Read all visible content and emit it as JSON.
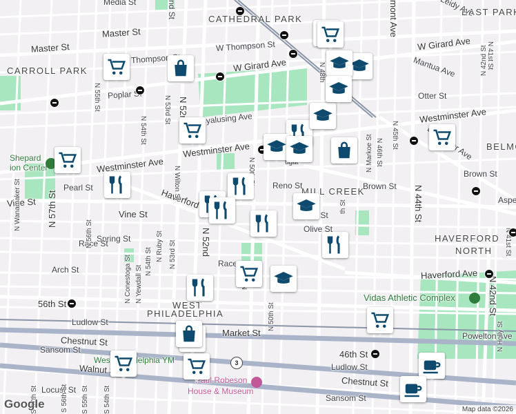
{
  "map": {
    "neighborhoods": [
      "CATHEDRAL PARK",
      "EAST PARK",
      "CARROLL PARK",
      "MILL CREEK",
      "HAVERFORD",
      "NORTH",
      "WEST",
      "PHILADELPHIA",
      "BELMO"
    ],
    "streets": {
      "master": "Master St",
      "w_girard_1": "W Girard Ave",
      "w_girard_2": "W Girard Ave",
      "w_thompson": "W Thompson St",
      "thompson": "Thompson St",
      "poplar": "Poplar St",
      "westminster_1": "Westminster Ave",
      "westminster_2": "Westminster Ave",
      "westminster_3": "Westminster Ave",
      "pearl": "Pearl St",
      "vine": "Vine St",
      "vine_2": "Vine St",
      "haverford": "Haverford Ave",
      "haverford_2": "Haverford Ave",
      "spring": "Spring St",
      "race": "Race St",
      "race_2": "Race",
      "arch": "Arch St",
      "56th": "56th St",
      "ludlow": "Ludlow St",
      "ludlow_2": "Ludlow St",
      "market": "Market St",
      "chestnut": "Chestnut St",
      "chestnut_2": "Chestnut St",
      "sansom": "Sansom St",
      "sansom_2": "Sansom St",
      "walnut": "Walnut St",
      "locust": "Locust St",
      "reno": "Reno St",
      "brown": "Brown St",
      "brown_2": "Brown St",
      "olive": "Olive St",
      "aspen": "Aspen St",
      "aspe": "Aspe",
      "lancaster": "Lancaster Ave",
      "powelton": "Powelton Ave",
      "mantua": "Mantua Ave",
      "otter": "Otter St",
      "leidy": "Leidy Ave",
      "media": "Media St",
      "cya": "Cyalusing Ave",
      "n57": "N 57th St",
      "n56": "N 56th St",
      "n55": "N 55th St",
      "n54": "N 54th St",
      "n53": "N 53rd St",
      "n52": "N 52nd St",
      "n52b": "N 52nd",
      "n51": "N 51",
      "n50": "N 50th St",
      "n50b": "N 50th St",
      "n49": "49th",
      "n48": "N 48th",
      "n46": "N 46th St",
      "n45": "N 45th St",
      "n44": "N 44th St",
      "n42": "N 42nd St",
      "n42b": "N 42nd St",
      "n41": "N 41st St",
      "n41b": "N 41st St",
      "n54b": "N 54th St",
      "s54": "S 54th St",
      "s55": "S 55th St",
      "s56": "S 56th St",
      "s57": "S 57th St",
      "wanamaker": "N Wanamaker St",
      "conestoga": "N Conestoga St",
      "yewdall": "N Yewdall St",
      "ruby": "N Ruby St",
      "wilton": "N Wilton St",
      "markoe": "N Markoe St",
      "holly": "N Holly St",
      "fairmont": "mont Ave",
      "nd": "nd St",
      "ugat": "ugat",
      "h_st": "th St",
      "arch_st": "Arch St",
      "n46b": "46th St",
      "n52c": "52",
      "n48c": "48th",
      "n53c": "N 53rd St",
      "shepard": "Shepard",
      "shepard2": "ion Center",
      "ymca": "West Philadelphia YM",
      "robeson1": "Paul Robeson",
      "robeson2": "House & Museum",
      "vidas": "Vidas Athletic Complex",
      "hwy3": "3"
    },
    "footer": {
      "logo": "Google",
      "credit": "Map data ©2026"
    },
    "colors": {
      "park": "#a8e6bf",
      "water": "#aadaff",
      "rail": "#8a95a8",
      "street": "#ffffff",
      "marker_icon": "#0e4a6e",
      "poi_green": "#2f7d3c",
      "poi_pink": "#c2579a"
    },
    "markers": [
      {
        "type": "grocery-icon"
      },
      {
        "type": "grocery-icon"
      },
      {
        "type": "grocery-icon"
      },
      {
        "type": "grocery-icon"
      },
      {
        "type": "grocery-icon"
      },
      {
        "type": "grocery-icon"
      },
      {
        "type": "grocery-icon"
      },
      {
        "type": "grocery-icon"
      },
      {
        "type": "grocery-icon"
      },
      {
        "type": "grocery-icon"
      },
      {
        "type": "shopping-bag-icon"
      },
      {
        "type": "shopping-bag-icon"
      },
      {
        "type": "shopping-bag-icon"
      },
      {
        "type": "shopping-bag-icon"
      },
      {
        "type": "restaurant-icon"
      },
      {
        "type": "restaurant-icon"
      },
      {
        "type": "restaurant-icon"
      },
      {
        "type": "restaurant-icon"
      },
      {
        "type": "restaurant-icon"
      },
      {
        "type": "restaurant-icon"
      },
      {
        "type": "restaurant-icon"
      },
      {
        "type": "restaurant-icon"
      },
      {
        "type": "school-icon"
      },
      {
        "type": "school-icon"
      },
      {
        "type": "school-icon"
      },
      {
        "type": "school-icon"
      },
      {
        "type": "school-icon"
      },
      {
        "type": "school-icon"
      },
      {
        "type": "school-icon"
      },
      {
        "type": "school-icon"
      },
      {
        "type": "cafe-icon"
      },
      {
        "type": "cafe-icon"
      }
    ]
  }
}
